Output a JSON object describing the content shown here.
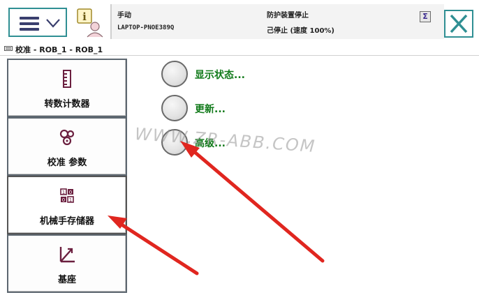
{
  "header": {
    "menu_button": "main-menu",
    "mode_label": "手动",
    "controller_name": "LAPTOP-PNOE389Q",
    "safety_status": "防护装置停止",
    "run_status": "己停止 (速度 100%)"
  },
  "breadcrumb": {
    "text": "校准 - ROB_1 - ROB_1"
  },
  "sidebar": {
    "items": [
      {
        "label": "转数计数器",
        "icon": "revolution-counter-icon"
      },
      {
        "label": "校准 参数",
        "icon": "calibration-parameters-icon"
      },
      {
        "label": "机械手存储器",
        "icon": "manipulator-memory-icon"
      },
      {
        "label": "基座",
        "icon": "base-frame-icon"
      }
    ],
    "active_index": 2
  },
  "options": [
    {
      "label": "显示状态..."
    },
    {
      "label": "更新..."
    },
    {
      "label": "高级..."
    }
  ],
  "watermark": "WWW.ZR-ABB.COM",
  "colors": {
    "accent": "#2f8f93",
    "option_text": "#117a1a",
    "arrow": "#e0261f"
  }
}
